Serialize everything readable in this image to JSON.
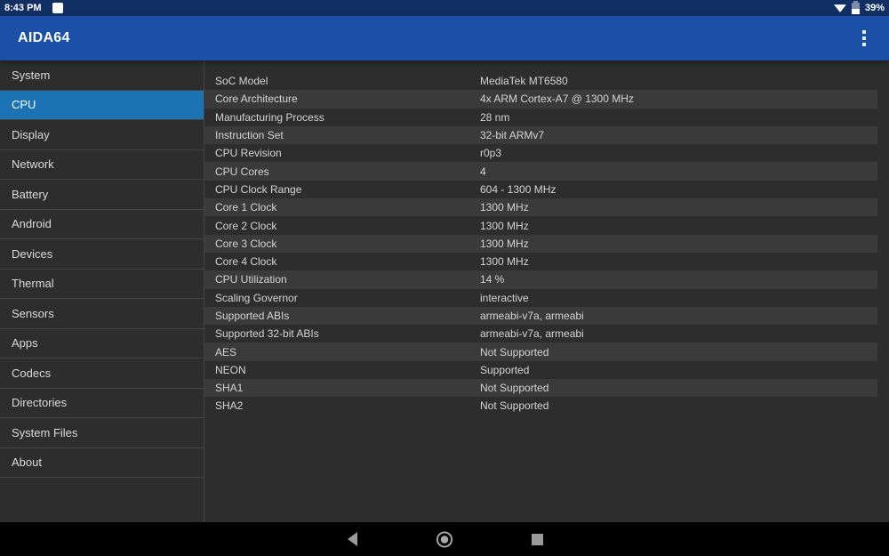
{
  "status_bar": {
    "time": "8:43 PM",
    "battery_percent": "39%",
    "icons": [
      "screenshot-notification-icon",
      "wifi-icon",
      "battery-icon"
    ]
  },
  "app_bar": {
    "title": "AIDA64",
    "menu_icon": "kebab-menu-icon"
  },
  "sidebar": {
    "items": [
      {
        "label": "System",
        "active": false
      },
      {
        "label": "CPU",
        "active": true
      },
      {
        "label": "Display",
        "active": false
      },
      {
        "label": "Network",
        "active": false
      },
      {
        "label": "Battery",
        "active": false
      },
      {
        "label": "Android",
        "active": false
      },
      {
        "label": "Devices",
        "active": false
      },
      {
        "label": "Thermal",
        "active": false
      },
      {
        "label": "Sensors",
        "active": false
      },
      {
        "label": "Apps",
        "active": false
      },
      {
        "label": "Codecs",
        "active": false
      },
      {
        "label": "Directories",
        "active": false
      },
      {
        "label": "System Files",
        "active": false
      },
      {
        "label": "About",
        "active": false
      }
    ]
  },
  "cpu_info": {
    "rows": [
      {
        "label": "SoC Model",
        "value": "MediaTek MT6580"
      },
      {
        "label": "Core Architecture",
        "value": "4x ARM Cortex-A7 @ 1300 MHz"
      },
      {
        "label": "Manufacturing Process",
        "value": "28 nm"
      },
      {
        "label": "Instruction Set",
        "value": "32-bit ARMv7"
      },
      {
        "label": "CPU Revision",
        "value": "r0p3"
      },
      {
        "label": "CPU Cores",
        "value": "4"
      },
      {
        "label": "CPU Clock Range",
        "value": "604 - 1300 MHz"
      },
      {
        "label": "Core 1 Clock",
        "value": "1300 MHz"
      },
      {
        "label": "Core 2 Clock",
        "value": "1300 MHz"
      },
      {
        "label": "Core 3 Clock",
        "value": "1300 MHz"
      },
      {
        "label": "Core 4 Clock",
        "value": "1300 MHz"
      },
      {
        "label": "CPU Utilization",
        "value": "14 %"
      },
      {
        "label": "Scaling Governor",
        "value": "interactive"
      },
      {
        "label": "Supported ABIs",
        "value": "armeabi-v7a, armeabi"
      },
      {
        "label": "Supported 32-bit ABIs",
        "value": "armeabi-v7a, armeabi"
      },
      {
        "label": "AES",
        "value": "Not Supported"
      },
      {
        "label": "NEON",
        "value": "Supported"
      },
      {
        "label": "SHA1",
        "value": "Not Supported"
      },
      {
        "label": "SHA2",
        "value": "Not Supported"
      }
    ]
  },
  "nav_bar": {
    "buttons": [
      "back-button",
      "home-button",
      "recents-button"
    ]
  },
  "colors": {
    "status_bar_bg": "#122f64",
    "app_bar_bg": "#1b50a7",
    "active_sidebar_bg": "#1b73b4",
    "panel_bg": "#2d2d2d",
    "row_alt_bg": "#3a3a3a",
    "divider": "#424242",
    "text": "#d4d4d4",
    "nav_icon": "#9a9a9a"
  }
}
